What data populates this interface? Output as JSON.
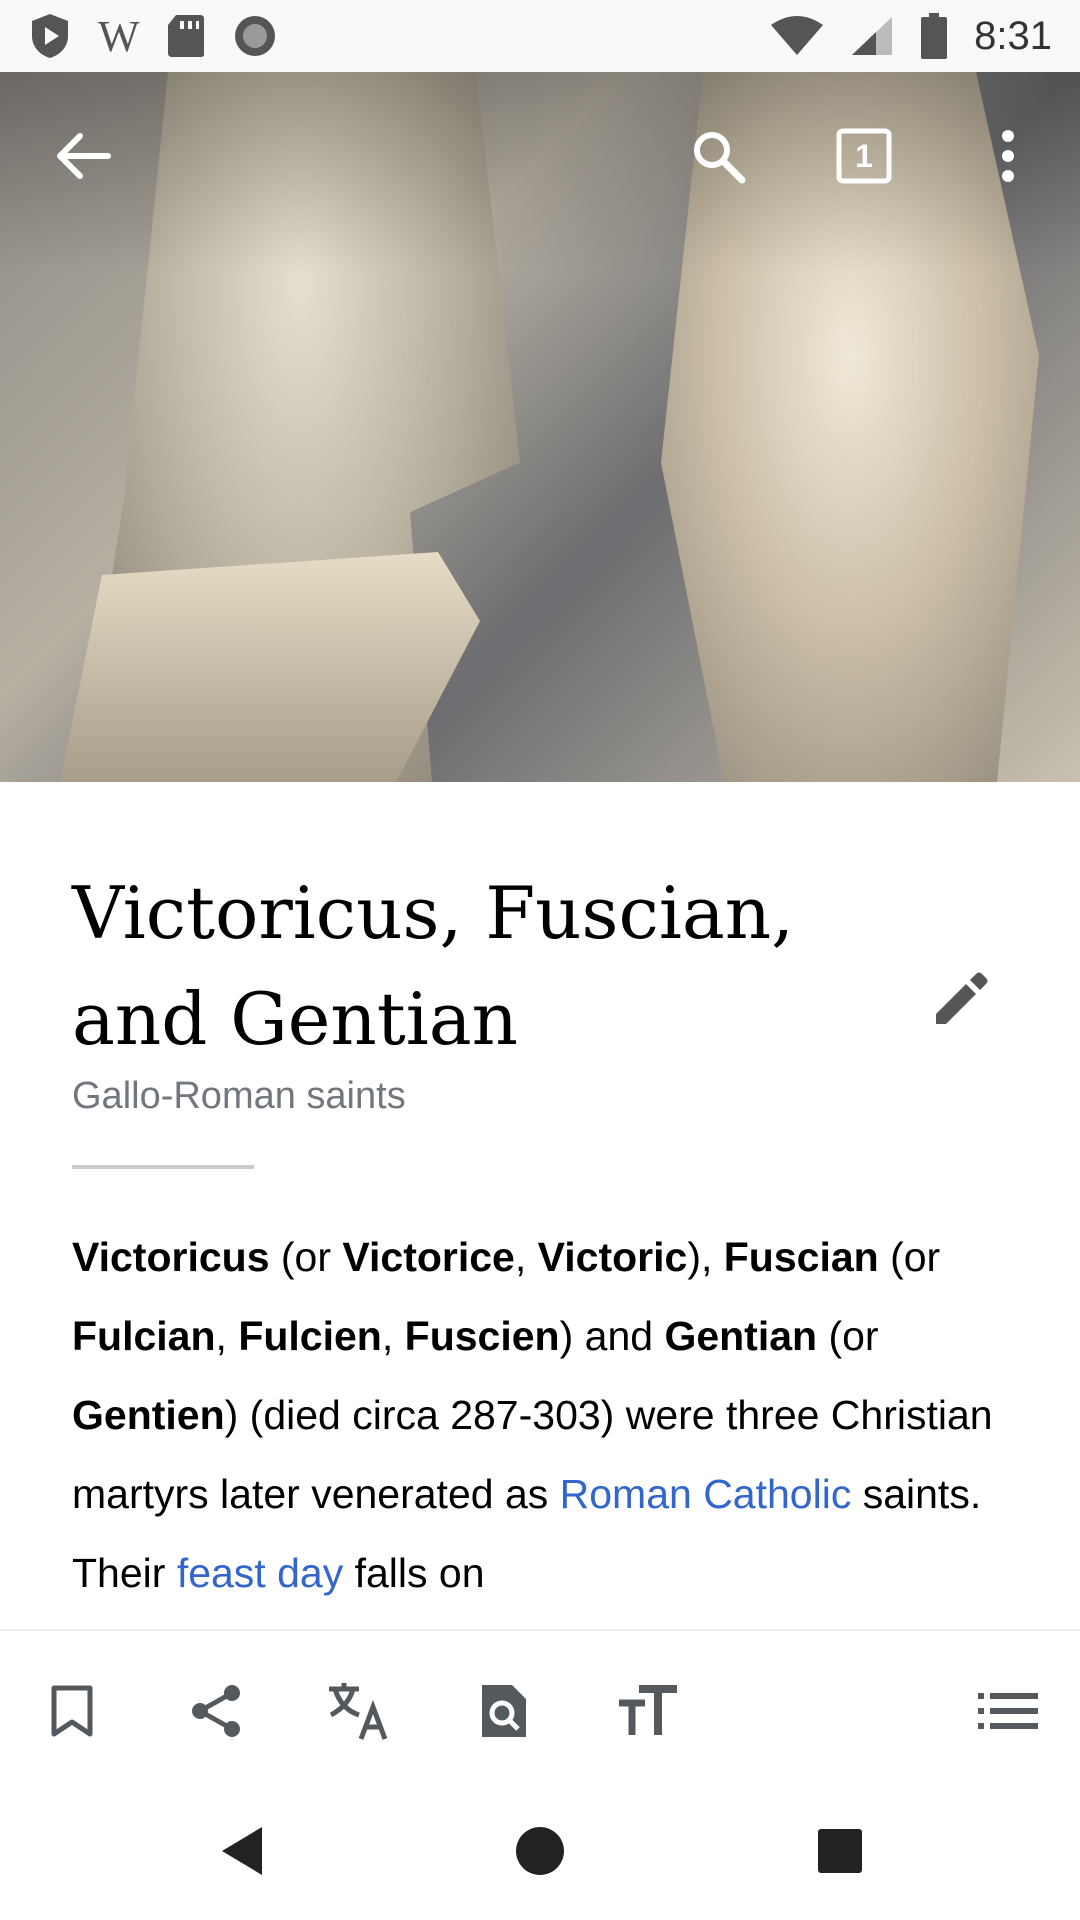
{
  "status_bar": {
    "time": "8:31",
    "wiki_glyph": "W",
    "icons": [
      "play-protect-icon",
      "wikipedia-icon",
      "sd-card-icon",
      "sync-icon",
      "wifi-icon",
      "signal-icon",
      "battery-icon"
    ]
  },
  "toolbar": {
    "tab_count": "1",
    "icons": [
      "back-arrow-icon",
      "search-icon",
      "tabs-icon",
      "overflow-menu-icon"
    ]
  },
  "article": {
    "title": "Victoricus, Fuscian, and Gentian",
    "description": "Gallo-Roman saints",
    "intro": {
      "t1": "Victoricus",
      "t2": " (or ",
      "t3": "Victorice",
      "t4": ", ",
      "t5": "Victoric",
      "t6": "), ",
      "t7": "Fuscian",
      "t8": " (or ",
      "t9": "Fulcian",
      "t10": ", ",
      "t11": "Fulcien",
      "t12": ", ",
      "t13": "Fuscien",
      "t14": ") and ",
      "t15": "Gentian",
      "t16": " (or ",
      "t17": "Gentien",
      "t18": ") (died circa 287-303) were three Christian martyrs later venerated as ",
      "link1": "Roman Catholic",
      "t19": " saints. Their ",
      "link2": "feast day",
      "t20": " falls on"
    }
  },
  "actions": [
    "bookmark-icon",
    "share-icon",
    "translate-icon",
    "find-in-page-icon",
    "text-size-icon",
    "contents-icon"
  ],
  "nav": [
    "nav-back-icon",
    "nav-home-icon",
    "nav-recents-icon"
  ],
  "colors": {
    "link": "#3366cc",
    "muted": "#72777d",
    "divider": "#c8ccd1"
  }
}
